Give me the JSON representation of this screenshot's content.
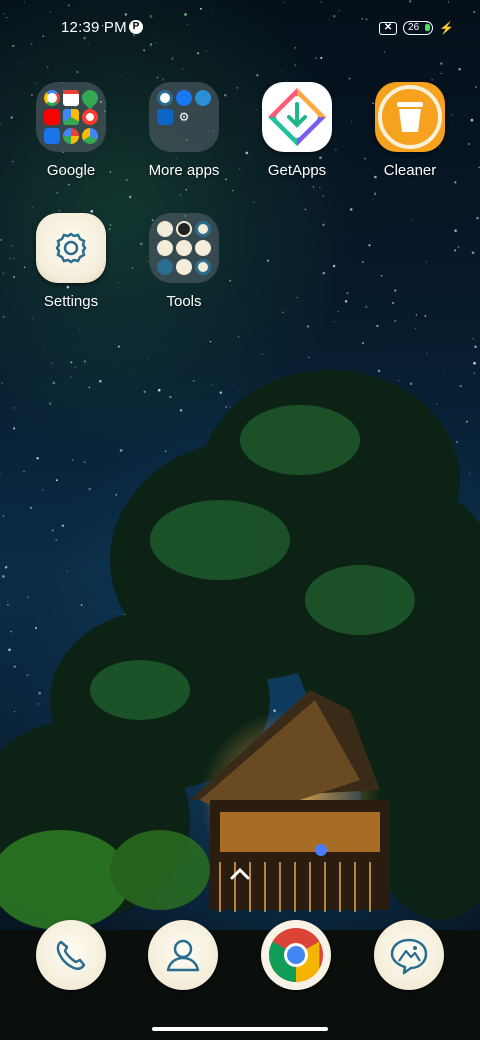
{
  "status_bar": {
    "time": "12:39 PM",
    "notification_icon": "p-notification-icon",
    "sim_icon": "no-sim-icon",
    "battery_level": "26",
    "charging_icon": "bolt-icon"
  },
  "apps": [
    {
      "label": "Google",
      "icon": "google-folder"
    },
    {
      "label": "More apps",
      "icon": "more-apps-folder"
    },
    {
      "label": "GetApps",
      "icon": "getapps-icon"
    },
    {
      "label": "Cleaner",
      "icon": "cleaner-icon"
    },
    {
      "label": "Settings",
      "icon": "settings-gear-icon"
    },
    {
      "label": "Tools",
      "icon": "tools-folder"
    }
  ],
  "dock": [
    {
      "name": "phone",
      "icon": "phone-icon"
    },
    {
      "name": "contacts",
      "icon": "contacts-icon"
    },
    {
      "name": "chrome",
      "icon": "chrome-icon"
    },
    {
      "name": "gallery",
      "icon": "gallery-icon"
    }
  ],
  "colors": {
    "cream": "#f3ecd8",
    "icon_stroke": "#2b6d8f",
    "cleaner_orange": "#f6a21e",
    "battery_green": "#4cd964"
  }
}
